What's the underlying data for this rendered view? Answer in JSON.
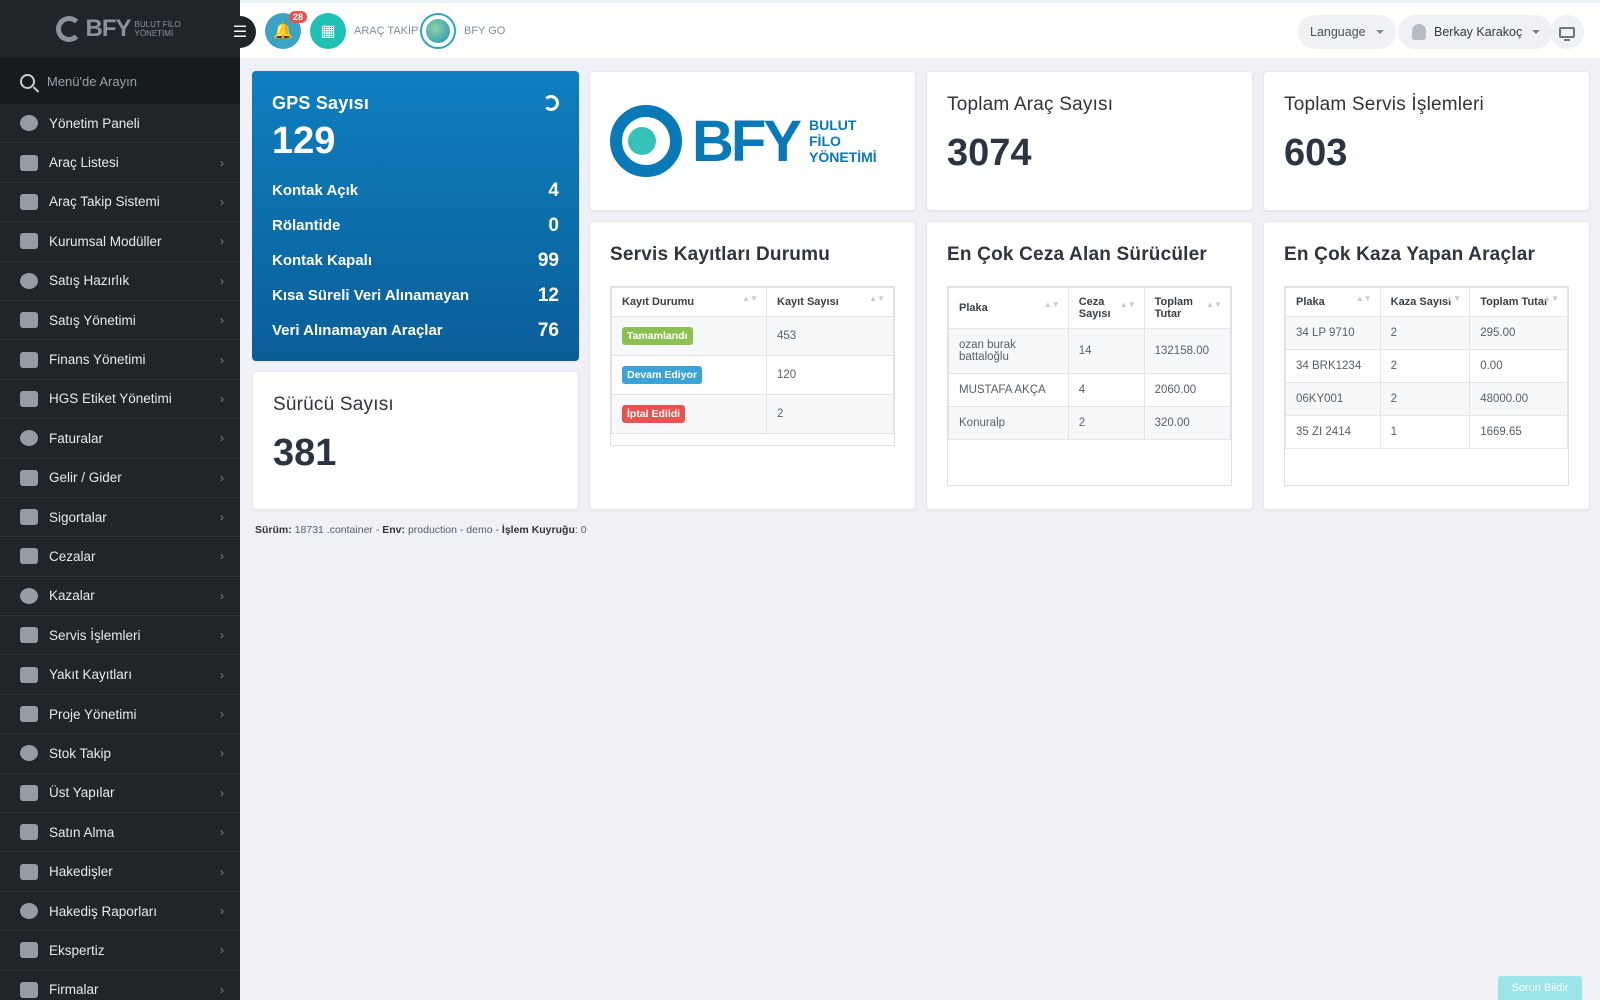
{
  "logo_small": {
    "brand": "BFY",
    "sub": "BULUT FİLO YÖNETİMİ"
  },
  "sidebar": {
    "search_placeholder": "Menü'de Arayın",
    "items": [
      {
        "label": "Yönetim Paneli",
        "icon": "dashboard-icon",
        "has_children": false
      },
      {
        "label": "Araç Listesi",
        "icon": "bus-icon",
        "has_children": true
      },
      {
        "label": "Araç Takip Sistemi",
        "icon": "map-pin-icon",
        "has_children": true
      },
      {
        "label": "Kurumsal Modüller",
        "icon": "server-icon",
        "has_children": true
      },
      {
        "label": "Satış Hazırlık",
        "icon": "book-icon",
        "has_children": true
      },
      {
        "label": "Satış Yönetimi",
        "icon": "layers-icon",
        "has_children": true
      },
      {
        "label": "Finans Yönetimi",
        "icon": "money-icon",
        "has_children": true
      },
      {
        "label": "HGS Etiket Yönetimi",
        "icon": "tag-icon",
        "has_children": true
      },
      {
        "label": "Faturalar",
        "icon": "file-icon",
        "has_children": true
      },
      {
        "label": "Gelir / Gider",
        "icon": "cash-icon",
        "has_children": true
      },
      {
        "label": "Sigortalar",
        "icon": "umbrella-icon",
        "has_children": true
      },
      {
        "label": "Cezalar",
        "icon": "close-circle-icon",
        "has_children": true
      },
      {
        "label": "Kazalar",
        "icon": "car-crash-icon",
        "has_children": true
      },
      {
        "label": "Servis İşlemleri",
        "icon": "check-circle-icon",
        "has_children": true
      },
      {
        "label": "Yakıt Kayıtları",
        "icon": "fuel-icon",
        "has_children": true
      },
      {
        "label": "Proje Yönetimi",
        "icon": "briefcase-icon",
        "has_children": true
      },
      {
        "label": "Stok Takip",
        "icon": "inbox-icon",
        "has_children": true
      },
      {
        "label": "Üst Yapılar",
        "icon": "truck-icon",
        "has_children": true
      },
      {
        "label": "Satın Alma",
        "icon": "credit-card-icon",
        "has_children": true
      },
      {
        "label": "Hakedişler",
        "icon": "truck-icon",
        "has_children": true
      },
      {
        "label": "Hakediş Raporları",
        "icon": "truck-icon",
        "has_children": true
      },
      {
        "label": "Ekspertiz",
        "icon": "report-icon",
        "has_children": true
      },
      {
        "label": "Firmalar",
        "icon": "building-icon",
        "has_children": true
      }
    ]
  },
  "topbar": {
    "notifications_count": "28",
    "arac_takip": "ARAÇ TAKİP",
    "bfy_go": "BFY GO",
    "language": "Language",
    "user_name": "Berkay Karakoç"
  },
  "gps": {
    "title": "GPS Sayısı",
    "total": "129",
    "rows": [
      {
        "label": "Kontak Açık",
        "value": "4"
      },
      {
        "label": "Rölantide",
        "value": "0"
      },
      {
        "label": "Kontak Kapalı",
        "value": "99"
      },
      {
        "label": "Kısa Süreli Veri Alınamayan",
        "value": "12"
      },
      {
        "label": "Veri Alınamayan Araçlar",
        "value": "76"
      }
    ]
  },
  "logo_big": {
    "brand": "BFY",
    "line1": "BULUT",
    "line2": "FİLO",
    "line3": "YÖNETİMİ"
  },
  "vehicles": {
    "title": "Toplam Araç Sayısı",
    "value": "3074"
  },
  "services": {
    "title": "Toplam Servis İşlemleri",
    "value": "603"
  },
  "drivers": {
    "title": "Sürücü Sayısı",
    "value": "381"
  },
  "service_status": {
    "title": "Servis Kayıtları Durumu",
    "headers": [
      "Kayıt Durumu",
      "Kayıt Sayısı"
    ],
    "rows": [
      {
        "status": "Tamamlandı",
        "color": "#8cc152",
        "count": "453"
      },
      {
        "status": "Devam Ediyor",
        "color": "#3aa3d8",
        "count": "120"
      },
      {
        "status": "İptal Edildi",
        "color": "#e9534f",
        "count": "2"
      }
    ]
  },
  "top_fines": {
    "title": "En Çok Ceza Alan Sürücüler",
    "headers": [
      "Plaka",
      "Ceza Sayısı",
      "Toplam Tutar"
    ],
    "rows": [
      [
        "ozan burak battaloğlu",
        "14",
        "132158.00"
      ],
      [
        "MUSTAFA AKÇA",
        "4",
        "2060.00"
      ],
      [
        "Konuralp",
        "2",
        "320.00"
      ]
    ]
  },
  "top_accidents": {
    "title": "En Çok Kaza Yapan Araçlar",
    "headers": [
      "Plaka",
      "Kaza Sayısı",
      "Toplam Tutar"
    ],
    "rows": [
      [
        "34 LP 9710",
        "2",
        "295.00"
      ],
      [
        "34 BRK1234",
        "2",
        "0.00"
      ],
      [
        "06KY001",
        "2",
        "48000.00"
      ],
      [
        "35 ZI 2414",
        "1",
        "1669.65"
      ]
    ]
  },
  "footer": {
    "version_label": "Sürüm:",
    "version_value": "18731 .container",
    "env_label": "Env:",
    "env_value": "production - demo",
    "queue_label": "İşlem Kuyruğu",
    "queue_value": ": 0"
  },
  "report_button": "Sorun Bildir"
}
